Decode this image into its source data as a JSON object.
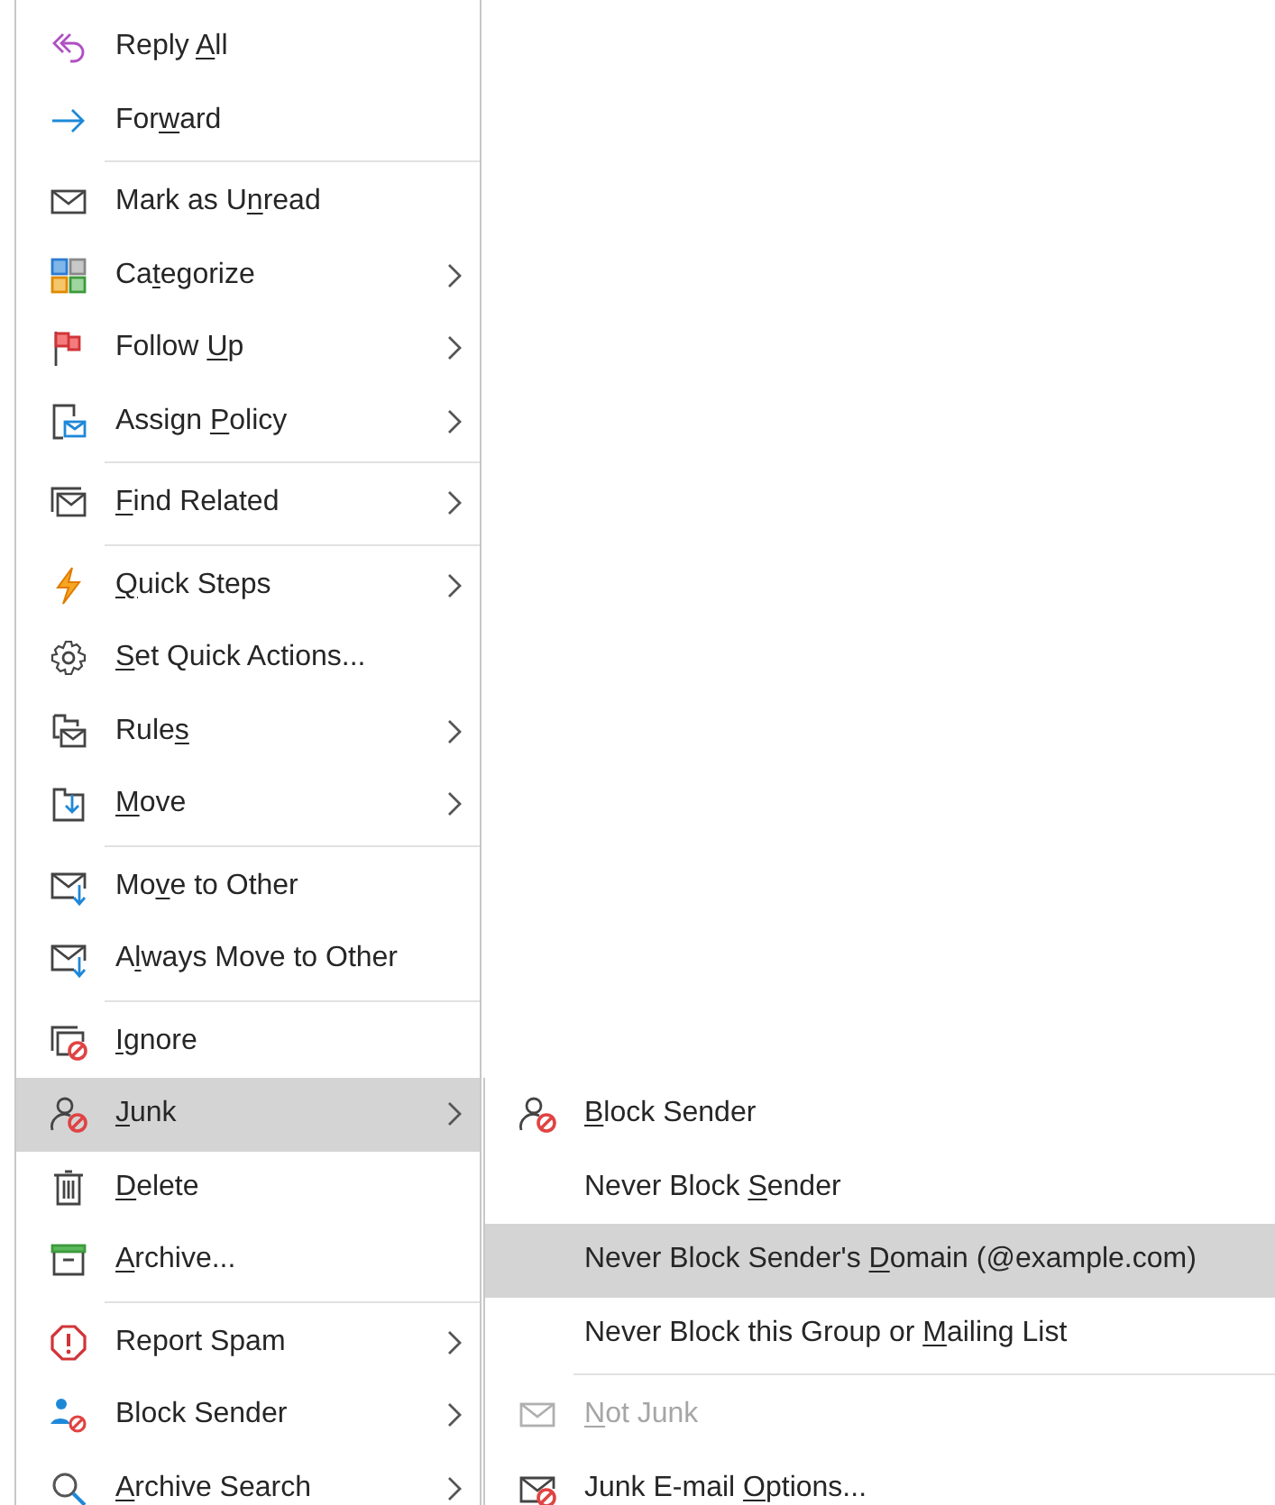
{
  "menu": {
    "groups": [
      {
        "items": [
          {
            "label": {
              "before": "Reply ",
              "key": "A",
              "after": "ll"
            },
            "has_submenu": false,
            "selected": false
          },
          {
            "label": {
              "before": "For",
              "key": "w",
              "after": "ard"
            },
            "has_submenu": false,
            "selected": false
          }
        ]
      },
      {
        "items": [
          {
            "label": {
              "before": "Mark as U",
              "key": "n",
              "after": "read"
            },
            "has_submenu": false,
            "selected": false
          },
          {
            "label": {
              "before": "Ca",
              "key": "t",
              "after": "egorize"
            },
            "has_submenu": true,
            "selected": false
          },
          {
            "label": {
              "before": "Follow ",
              "key": "U",
              "after": "p"
            },
            "has_submenu": true,
            "selected": false
          },
          {
            "label": {
              "before": "Assign ",
              "key": "P",
              "after": "olicy"
            },
            "has_submenu": true,
            "selected": false
          }
        ]
      },
      {
        "items": [
          {
            "label": {
              "key": "F",
              "after": "ind Related"
            },
            "has_submenu": true,
            "selected": false
          }
        ]
      },
      {
        "items": [
          {
            "label": {
              "key": "Q",
              "after": "uick Steps"
            },
            "has_submenu": true,
            "selected": false
          },
          {
            "label": {
              "key": "S",
              "after": "et Quick Actions..."
            },
            "has_submenu": false,
            "selected": false
          },
          {
            "label": {
              "before": "Rule",
              "key": "s"
            },
            "has_submenu": true,
            "selected": false
          },
          {
            "label": {
              "key": "M",
              "after": "ove"
            },
            "has_submenu": true,
            "selected": false
          }
        ]
      },
      {
        "items": [
          {
            "label": {
              "before": "Mo",
              "key": "v",
              "after": "e to Other"
            },
            "has_submenu": false,
            "selected": false
          },
          {
            "label": {
              "before": "A",
              "key": "l",
              "after": "ways Move to Other"
            },
            "has_submenu": false,
            "selected": false
          }
        ]
      },
      {
        "items": [
          {
            "label": {
              "key": "I",
              "after": "gnore"
            },
            "has_submenu": false,
            "selected": false
          },
          {
            "label": {
              "key": "J",
              "after": "unk"
            },
            "has_submenu": true,
            "selected": true
          },
          {
            "label": {
              "key": "D",
              "after": "elete"
            },
            "has_submenu": false,
            "selected": false
          },
          {
            "label": {
              "key": "A",
              "after": "rchive..."
            },
            "has_submenu": false,
            "selected": false
          }
        ]
      },
      {
        "items": [
          {
            "label": {
              "before": "Report Spam"
            },
            "has_submenu": true,
            "selected": false
          },
          {
            "label": {
              "before": "Block Sender"
            },
            "has_submenu": true,
            "selected": false
          },
          {
            "label": {
              "key": "A",
              "after": "rchive Search"
            },
            "has_submenu": true,
            "selected": false
          }
        ]
      }
    ]
  },
  "submenu": {
    "groups": [
      {
        "items": [
          {
            "label": {
              "key": "B",
              "after": "lock Sender"
            },
            "selected": false,
            "disabled": false
          },
          {
            "label": {
              "before": "Never Block ",
              "key": "S",
              "after": "ender"
            },
            "selected": false,
            "disabled": false
          },
          {
            "label": {
              "before": "Never Block Sender's ",
              "key": "D",
              "after": "omain (@example.com)"
            },
            "selected": true,
            "disabled": false
          },
          {
            "label": {
              "before": "Never Block this Group or ",
              "key": "M",
              "after": "ailing List"
            },
            "selected": false,
            "disabled": false
          }
        ]
      },
      {
        "items": [
          {
            "label": {
              "key": "N",
              "after": "ot Junk"
            },
            "selected": false,
            "disabled": true
          },
          {
            "label": {
              "before": "Junk E-mail ",
              "key": "O",
              "after": "ptions..."
            },
            "selected": false,
            "disabled": false
          }
        ]
      }
    ]
  }
}
